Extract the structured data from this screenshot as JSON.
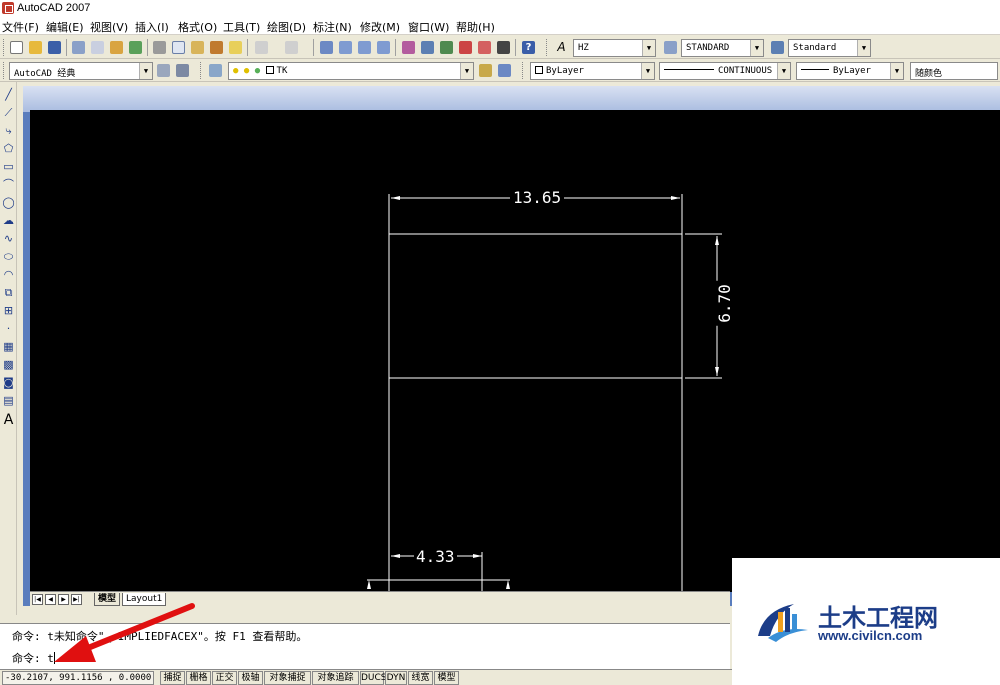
{
  "window": {
    "title": "AutoCAD 2007"
  },
  "menu": [
    "文件(F)",
    "编辑(E)",
    "视图(V)",
    "插入(I)",
    "格式(O)",
    "工具(T)",
    "绘图(D)",
    "标注(N)",
    "修改(M)",
    "窗口(W)",
    "帮助(H)"
  ],
  "toolbar1": {
    "text_style": "HZ",
    "dim_style": "STANDARD",
    "table_style": "Standard"
  },
  "toolbar2": {
    "workspace": "AutoCAD 经典",
    "layer": "TK",
    "color": "ByLayer",
    "linetype": "CONTINUOUS",
    "lineweight": "ByLayer",
    "plot_style": "随颜色"
  },
  "drawing": {
    "dim_width": "13.65",
    "dim_height": "6.70",
    "dim_small": "4.33"
  },
  "tabs": {
    "model": "模型",
    "layout": "Layout1"
  },
  "command": {
    "line1_prefix": "命令: ",
    "line1_text": "t未知命令\"_.IMPLIEDFACEX\"。按 F1 查看帮助。",
    "line2_prefix": "命令: ",
    "line2_text": "t"
  },
  "status": {
    "coords": "-30.2107, 991.1156 , 0.0000",
    "buttons": [
      "捕捉",
      "栅格",
      "正交",
      "极轴",
      "对象捕捉",
      "对象追踪",
      "DUCS",
      "DYN",
      "线宽",
      "模型"
    ]
  },
  "watermark": {
    "title": "土木工程网",
    "url": "www.civilcn.com"
  },
  "colors": {
    "canvas": "#000000",
    "annotation_arrow": "#e01010",
    "brand": "#1c3d88"
  }
}
